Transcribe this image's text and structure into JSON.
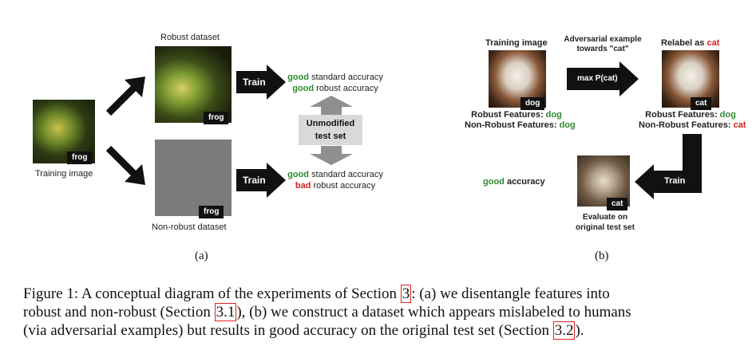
{
  "panel_a": {
    "robust_dataset_label": "Robust dataset",
    "non_robust_dataset_label": "Non-robust dataset",
    "training_image_label": "Training image",
    "tag_frog": "frog",
    "train_label": "Train",
    "top_result": {
      "line1_word": "good",
      "line1_rest": " standard accuracy",
      "line2_word": "good",
      "line2_rest": " robust accuracy"
    },
    "bottom_result": {
      "line1_word": "good",
      "line1_rest": " standard accuracy",
      "line2_word": "bad",
      "line2_rest": " robust accuracy"
    },
    "test_set_line1": "Unmodified",
    "test_set_line2": "test set",
    "sublabel": "(a)"
  },
  "panel_b": {
    "training_image_label": "Training image",
    "adversarial_line1": "Adversarial example",
    "adversarial_line2": "towards \"cat\"",
    "relabel_prefix": "Relabel as ",
    "relabel_word": "cat",
    "max_label": "max P(cat)",
    "tag_dog": "dog",
    "tag_cat": "cat",
    "left_features": {
      "robust_prefix": "Robust Features: ",
      "robust_value": "dog",
      "nonrobust_prefix": "Non-Robust Features: ",
      "nonrobust_value": "dog"
    },
    "right_features": {
      "robust_prefix": "Robust Features: ",
      "robust_value": "dog",
      "nonrobust_prefix": "Non-Robust Features: ",
      "nonrobust_value": "cat"
    },
    "train_label": "Train",
    "accuracy_word": "good",
    "accuracy_rest": " accuracy",
    "evaluate_line1": "Evaluate on",
    "evaluate_line2": "original test set",
    "sublabel": "(b)"
  },
  "caption": {
    "line1_a": "Figure 1: A conceptual diagram of the experiments of Section ",
    "ref1": "3",
    "line1_b": ": (a) we disentangle features into",
    "line2_a": "robust and non-robust (Section ",
    "ref2": "3.1",
    "line2_b": "), (b) we construct a dataset which appears mislabeled to humans",
    "line3_a": "(via adversarial examples) but results in good accuracy on the original test set (Section ",
    "ref3": "3.2",
    "line3_b": ")."
  },
  "colors": {
    "good": "#2e8b2e",
    "bad": "#d42020",
    "tag_bg": "#111111"
  }
}
